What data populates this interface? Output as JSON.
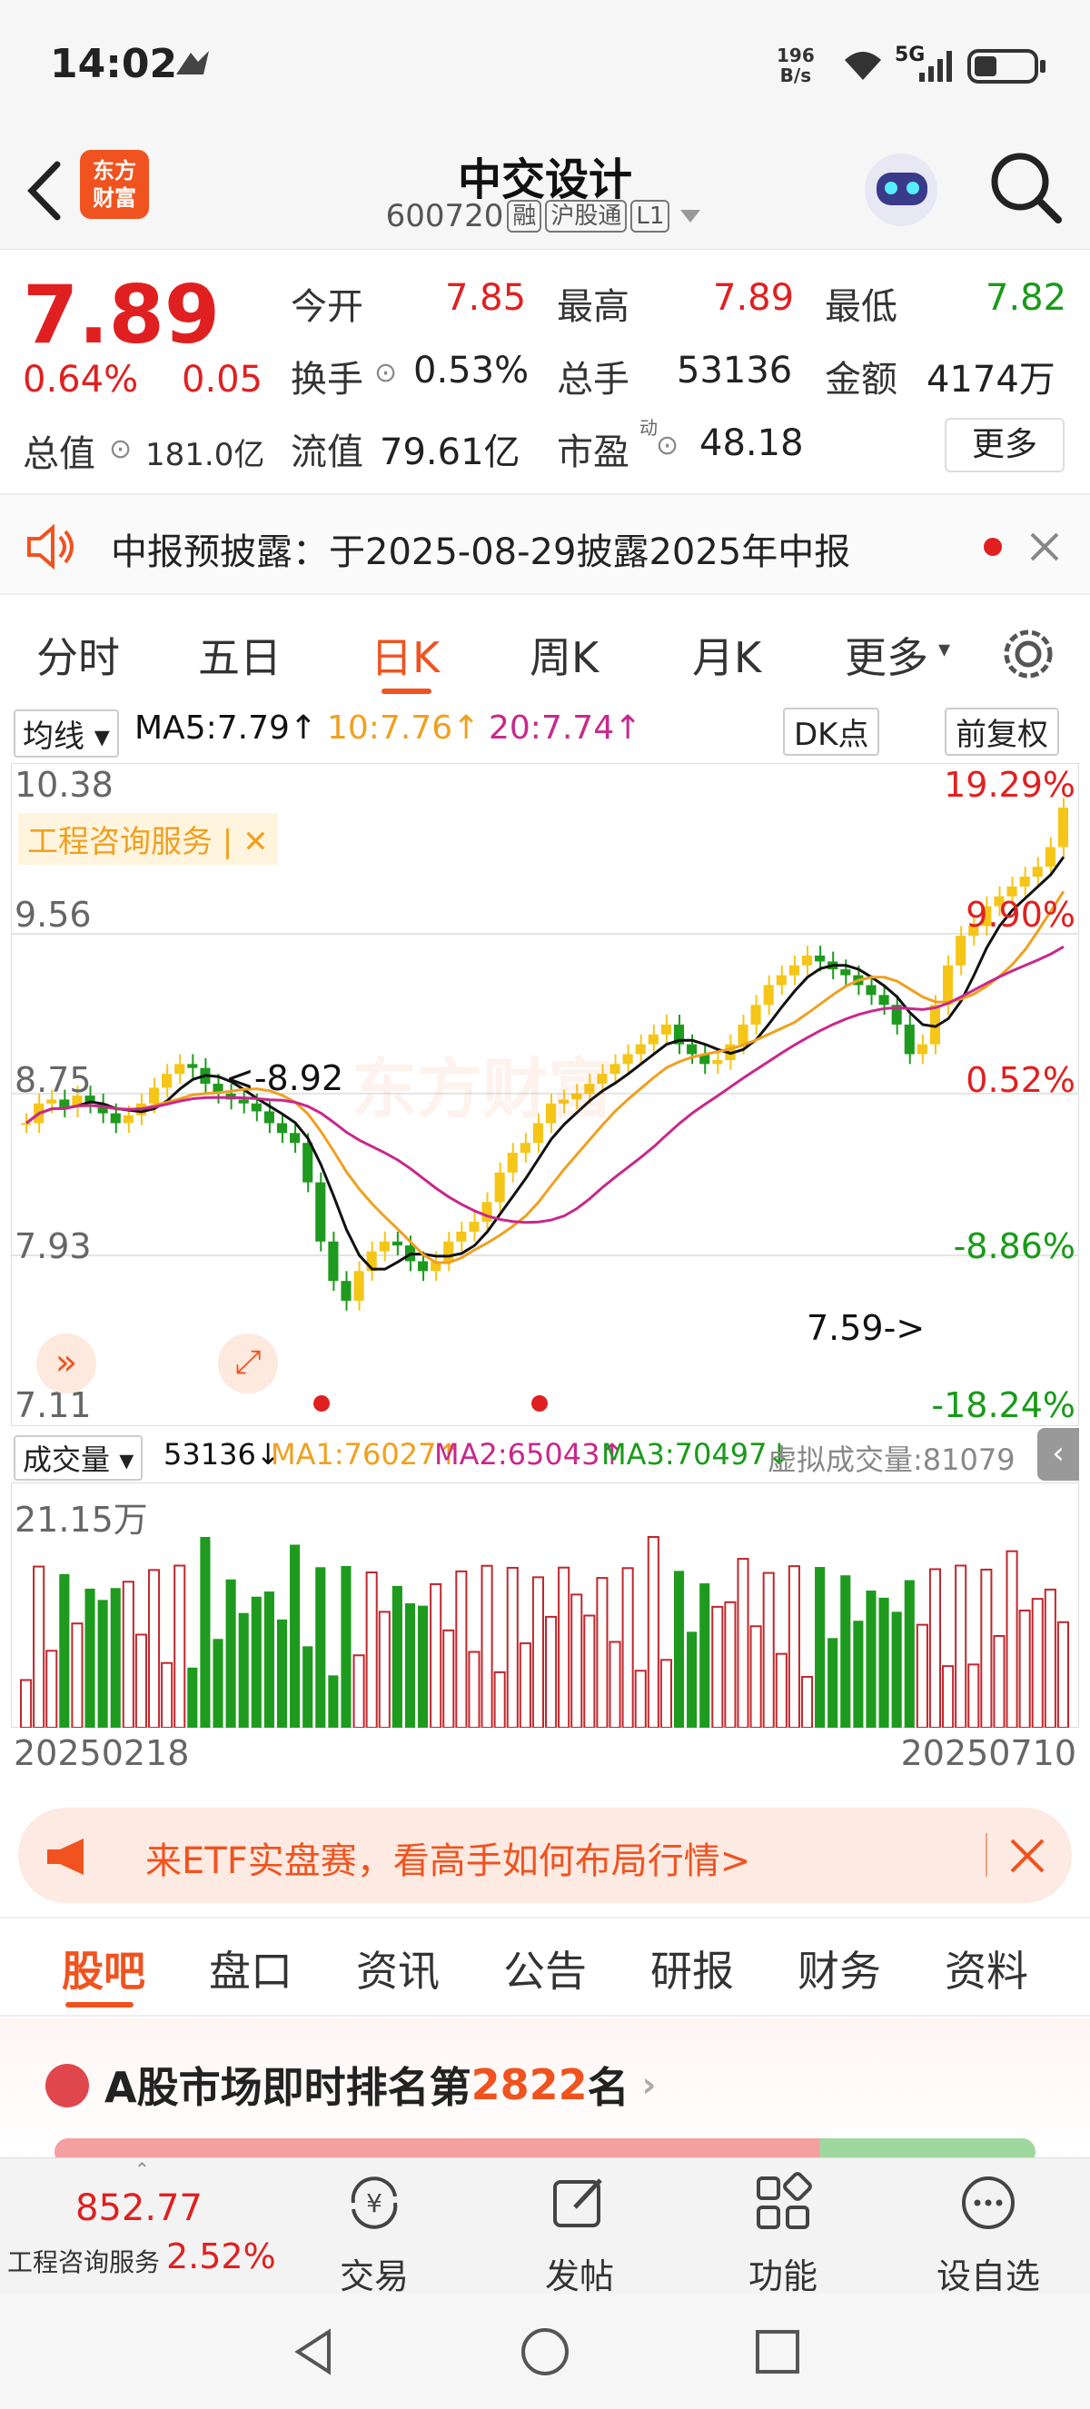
{
  "status_bar": {
    "time": "14:02",
    "net_speed_value": "196",
    "net_speed_unit": "B/s",
    "signal": "5G"
  },
  "header": {
    "stock_name": "中交设计",
    "stock_code": "600720",
    "tags": [
      "融",
      "沪股通",
      "L1"
    ],
    "logo_line1": "东方",
    "logo_line2": "财富"
  },
  "quote": {
    "price": "7.89",
    "change_pct": "0.64%",
    "change_amt": "0.05",
    "open_label": "今开",
    "open": "7.85",
    "high_label": "最高",
    "high": "7.89",
    "low_label": "最低",
    "low": "7.82",
    "turnover_label": "换手",
    "turnover": "0.53%",
    "volume_label": "总手",
    "volume": "53136",
    "amount_label": "金额",
    "amount": "4174万",
    "mcap_label": "总值",
    "mcap": "181.0亿",
    "float_label": "流值",
    "float_value": "79.61亿",
    "pe_label": "市盈",
    "pe_sup": "动",
    "pe": "48.18",
    "more_button": "更多"
  },
  "notice": {
    "text": "中报预披露：于2025-08-29披露2025年中报"
  },
  "period_tabs": [
    "分时",
    "五日",
    "日K",
    "周K",
    "月K",
    "更多"
  ],
  "active_period": "日K",
  "ma_line": {
    "selector": "均线",
    "ma5": "MA5:7.79↑",
    "ma10": "10:7.76↑",
    "ma20": "20:7.74↑",
    "dk_button": "DK点",
    "adjust_button": "前复权"
  },
  "chart": {
    "y_labels": [
      "10.38",
      "9.56",
      "8.75",
      "7.93",
      "7.11"
    ],
    "pct_labels": [
      "19.29%",
      "9.90%",
      "0.52%",
      "-8.86%",
      "-18.24%"
    ],
    "sector_tag": "工程咨询服务",
    "annotation_high": "<-8.92",
    "annotation_low": "7.59->",
    "watermark": "东方财富",
    "colors": {
      "up": "#f5c518",
      "down": "#1e9a1e",
      "ma5": "#111111",
      "ma10": "#f0a020",
      "ma20": "#c8288c"
    }
  },
  "chart_data": {
    "type": "candlestick",
    "ylim": [
      7.11,
      10.38
    ],
    "x_start": "20250218",
    "x_end": "20250710",
    "annotations": [
      {
        "label": "8.92",
        "kind": "local high"
      },
      {
        "label": "7.59",
        "kind": "local low"
      }
    ],
    "series": [
      {
        "name": "MA5",
        "last": 7.79
      },
      {
        "name": "MA10",
        "last": 7.76
      },
      {
        "name": "MA20",
        "last": 7.74
      }
    ]
  },
  "volume": {
    "selector": "成交量",
    "value": "53136↓",
    "ma1": "MA1:76027↑",
    "ma2": "MA2:65043↑",
    "ma3": "MA3:70497↓",
    "virtual": "虚拟成交量:81079",
    "max_label": "21.15万",
    "date_start": "20250218",
    "date_end": "20250710"
  },
  "ad_banner": {
    "text": "来ETF实盘赛，看高手如何布局行情>"
  },
  "section_tabs": [
    "股吧",
    "盘口",
    "资讯",
    "公告",
    "研报",
    "财务",
    "资料"
  ],
  "active_section": "股吧",
  "ranking": {
    "prefix": "A股市场即时排名第",
    "rank": "2822",
    "suffix": "名"
  },
  "bottom_bar": {
    "index_value": "852.77",
    "index_name": "工程咨询服务",
    "index_pct": "2.52%",
    "items": [
      "交易",
      "发帖",
      "功能",
      "设自选"
    ]
  }
}
